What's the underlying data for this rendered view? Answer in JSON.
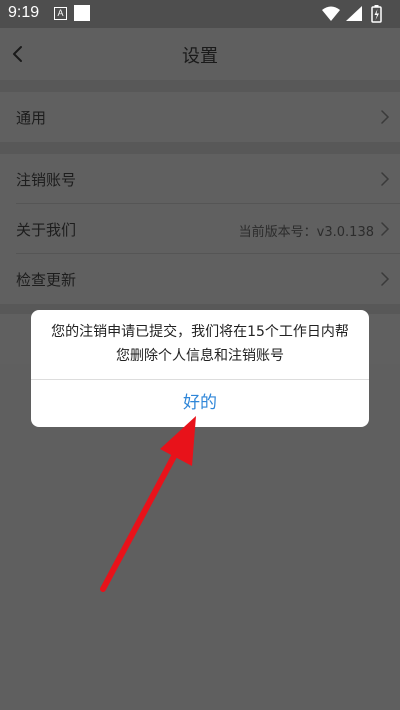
{
  "status_bar": {
    "time": "9:19",
    "notification_letter": "A"
  },
  "header": {
    "title": "设置",
    "back_icon": "chevron-left-icon"
  },
  "settings": {
    "general": {
      "label": "通用"
    },
    "cancel_account": {
      "label": "注销账号"
    },
    "about": {
      "label": "关于我们",
      "version": "当前版本号：v3.0.138"
    },
    "check_update": {
      "label": "检查更新"
    }
  },
  "dialog": {
    "message": "您的注销申请已提交，我们将在15个工作日内帮您删除个人信息和注销账号",
    "ok_label": "好的"
  },
  "colors": {
    "accent": "#2f86d8",
    "annotation_arrow": "#e8121a"
  }
}
